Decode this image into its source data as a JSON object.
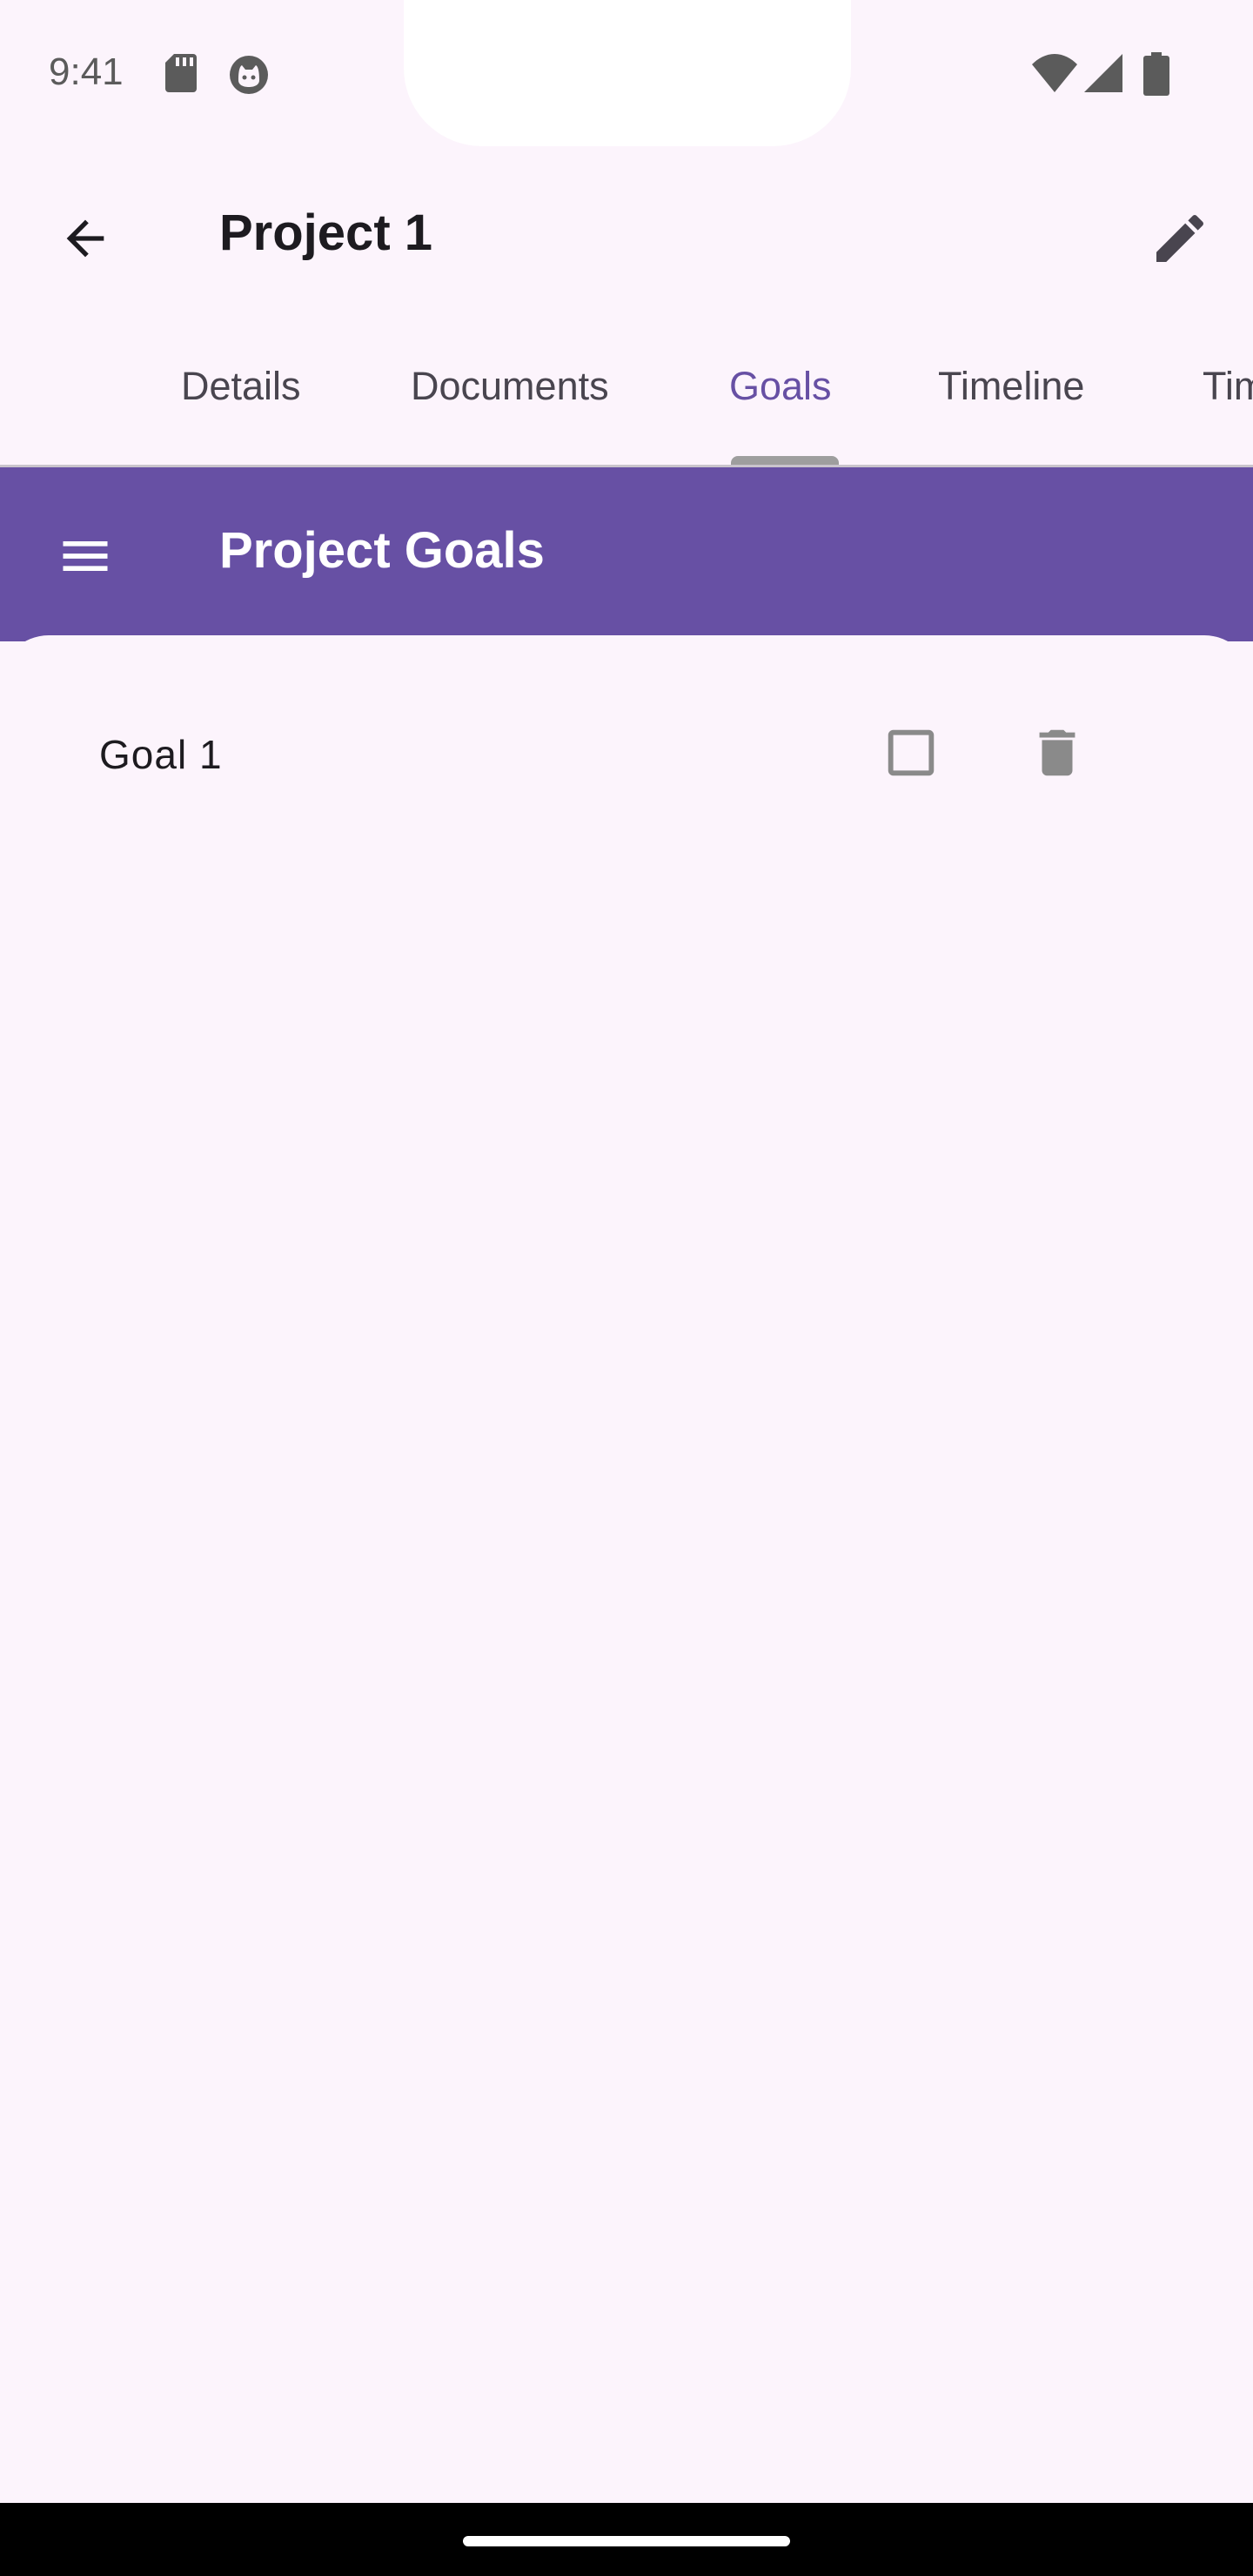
{
  "status_bar": {
    "time": "9:41",
    "icons": [
      "sd-card-icon",
      "cat-icon",
      "wifi-icon",
      "signal-icon",
      "battery-icon"
    ]
  },
  "app_bar": {
    "title": "Project 1",
    "back_icon": "arrow-back-icon",
    "edit_icon": "pencil-icon"
  },
  "tabs": {
    "items": [
      {
        "label": "Details"
      },
      {
        "label": "Documents"
      },
      {
        "label": "Goals"
      },
      {
        "label": "Timeline"
      },
      {
        "label": "Tim"
      }
    ],
    "active": "Goals"
  },
  "goals_header": {
    "title": "Project Goals",
    "menu_icon": "hamburger-menu-icon"
  },
  "goals": [
    {
      "label": "Goal 1",
      "completed": false
    }
  ],
  "colors": {
    "background": "#fcf4fc",
    "accent": "#6750a4",
    "text": "#1d1b20",
    "icon_muted": "#8a8a8a"
  }
}
